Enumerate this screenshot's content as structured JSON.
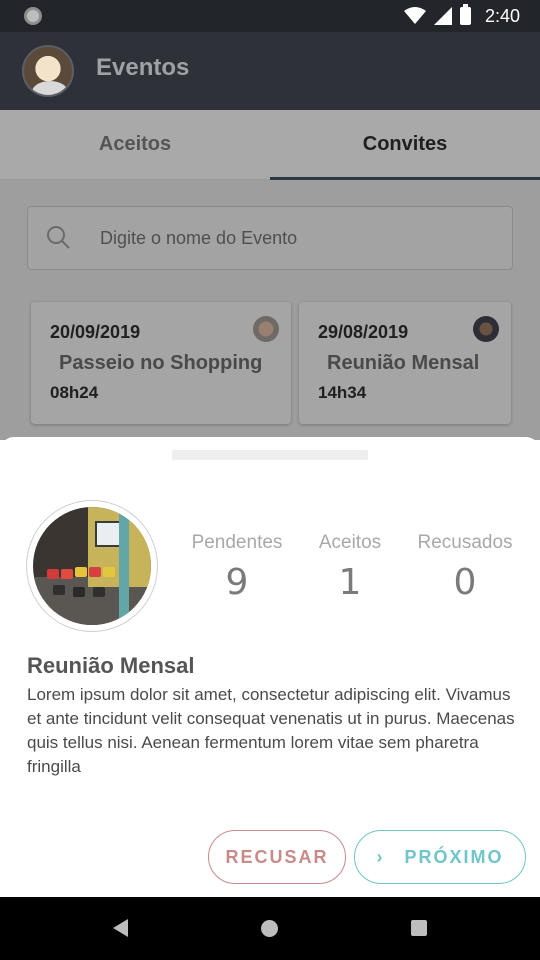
{
  "status_bar": {
    "time": "2:40"
  },
  "app_bar": {
    "title": "Eventos"
  },
  "tabs": [
    {
      "label": "Aceitos",
      "active": false
    },
    {
      "label": "Convites",
      "active": true
    }
  ],
  "search": {
    "placeholder": "Digite o nome do Evento"
  },
  "events": [
    {
      "date": "20/09/2019",
      "name": "Passeio no Shopping",
      "time": "08h24"
    },
    {
      "date": "29/08/2019",
      "name": "Reunião Mensal",
      "time": "14h34"
    }
  ],
  "sheet": {
    "stats": [
      {
        "label": "Pendentes",
        "value": "9"
      },
      {
        "label": "Aceitos",
        "value": "1"
      },
      {
        "label": "Recusados",
        "value": "0"
      }
    ],
    "title": "Reunião Mensal",
    "description": "Lorem ipsum dolor sit amet, consectetur adipiscing elit. Vivamus et ante tincidunt velit consequat venenatis ut in purus. Maecenas quis tellus nisi. Aenean fermentum lorem vitae sem pharetra fringilla",
    "reject_label": "RECUSAR",
    "next_label": "PRÓXIMO",
    "next_icon": "chevron-right-icon"
  },
  "colors": {
    "app_bar": "#2e3238",
    "reject": "#c98a8a",
    "next": "#6fc5c8"
  }
}
